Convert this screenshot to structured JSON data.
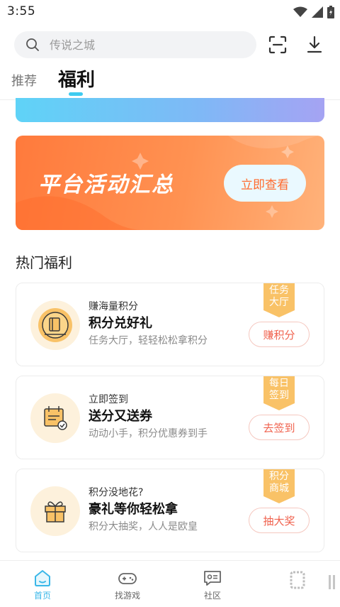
{
  "status_bar": {
    "time": "3:55"
  },
  "search": {
    "placeholder": "传说之城"
  },
  "tabs": {
    "recommend": "推荐",
    "welfare": "福利"
  },
  "promo_banner": {
    "title": "平台活动汇总",
    "button": "立即查看"
  },
  "section": {
    "title": "热门福利"
  },
  "cards": [
    {
      "subtitle": "赚海量积分",
      "title": "积分兑好礼",
      "desc": "任务大厅，轻轻松松拿积分",
      "tag_line1": "任务",
      "tag_line2": "大厅",
      "button": "赚积分"
    },
    {
      "subtitle": "立即签到",
      "title": "送分又送券",
      "desc": "动动小手，积分优惠券到手",
      "tag_line1": "每日",
      "tag_line2": "签到",
      "button": "去签到"
    },
    {
      "subtitle": "积分没地花?",
      "title": "豪礼等你轻松拿",
      "desc": "积分大抽奖，人人是欧皇",
      "tag_line1": "积分",
      "tag_line2": "商城",
      "button": "抽大奖"
    }
  ],
  "bottom_nav": {
    "home": "首页",
    "games": "找游戏",
    "community": "社区"
  },
  "colors": {
    "accent": "#3ab7e8",
    "orange": "#ff8a45",
    "tag": "#f9c267",
    "button_text": "#f0624e"
  },
  "icons": [
    "search-icon",
    "scan-icon",
    "download-icon",
    "wifi-icon",
    "signal-icon",
    "battery-icon",
    "home-icon",
    "gamepad-icon",
    "community-icon"
  ]
}
